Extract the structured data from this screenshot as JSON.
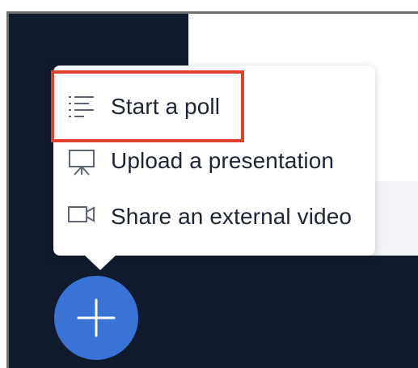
{
  "menu": {
    "items": [
      {
        "label": "Start a poll",
        "icon": "poll-list-icon"
      },
      {
        "label": "Upload a presentation",
        "icon": "presentation-icon"
      },
      {
        "label": "Share an external video",
        "icon": "video-camera-icon"
      }
    ]
  },
  "fab": {
    "icon": "plus-icon"
  },
  "colors": {
    "background": "#0f1a2c",
    "fab": "#3a73d6",
    "highlight": "#e0412f",
    "text": "#1d2433"
  }
}
